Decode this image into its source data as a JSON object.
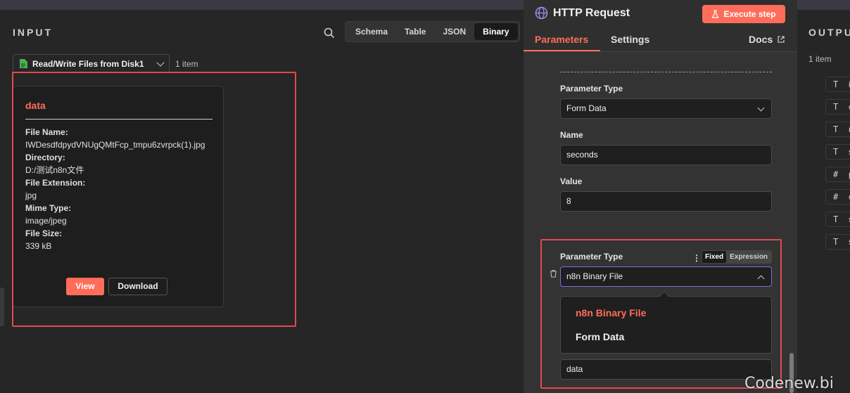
{
  "input": {
    "title": "INPUT",
    "view_tabs": [
      "Schema",
      "Table",
      "JSON",
      "Binary"
    ],
    "active_view": "Binary",
    "node_select": "Read/Write Files from Disk1",
    "item_count": "1 item",
    "binary": {
      "title": "data",
      "fields": [
        {
          "label": "File Name:",
          "value": "IWDesdfdpydVNUgQMtFcp_tmpu6zvrpck(1).jpg"
        },
        {
          "label": "Directory:",
          "value": "D:/测试n8n文件"
        },
        {
          "label": "File Extension:",
          "value": "jpg"
        },
        {
          "label": "Mime Type:",
          "value": "image/jpeg"
        },
        {
          "label": "File Size:",
          "value": "339 kB"
        }
      ],
      "view_label": "View",
      "download_label": "Download"
    }
  },
  "node": {
    "title": "HTTP Request",
    "execute_label": "Execute step",
    "tabs": {
      "parameters": "Parameters",
      "settings": "Settings",
      "docs": "Docs"
    },
    "params": {
      "param_type_label": "Parameter Type",
      "param_type_value": "Form Data",
      "name_label": "Name",
      "name_value": "seconds",
      "value_label": "Value",
      "value_value": "8",
      "param_type2_label": "Parameter Type",
      "param_type2_value": "n8n Binary File",
      "fixed_label": "Fixed",
      "expression_label": "Expression",
      "options": [
        "n8n Binary File",
        "Form Data"
      ],
      "bottom_value": "data"
    }
  },
  "output": {
    "title": "OUTPUT",
    "item_count": "1 item",
    "rows": [
      {
        "type": "T",
        "char": "i"
      },
      {
        "type": "T",
        "char": "c"
      },
      {
        "type": "T",
        "char": "n"
      },
      {
        "type": "T",
        "char": "s"
      },
      {
        "type": "#",
        "char": "p"
      },
      {
        "type": "#",
        "char": "c"
      },
      {
        "type": "T",
        "char": "s"
      },
      {
        "type": "T",
        "char": "s"
      }
    ]
  },
  "watermark": "Codenew.bi",
  "colors": {
    "accent": "#ff6d5a",
    "highlight": "#e5484d",
    "focus": "#7b6fe0"
  }
}
